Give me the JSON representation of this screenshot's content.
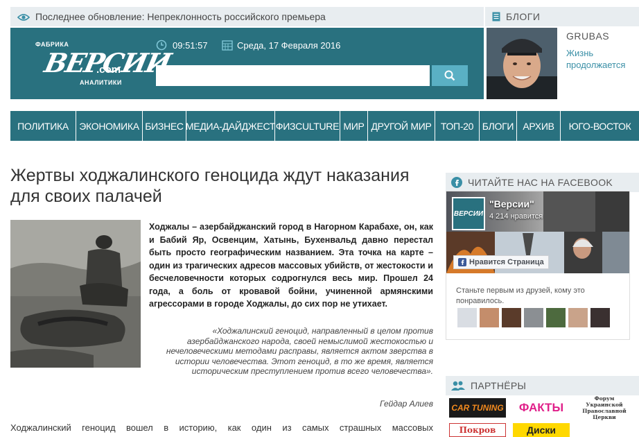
{
  "topbar": {
    "update_text": "Последнее обновление: Непреклонность российского премьера"
  },
  "blogs": {
    "label": "БЛОГИ",
    "author": "GRUBAS",
    "post": "Жизнь продолжается"
  },
  "logo": {
    "top": "ФАБРИКА",
    "main": "ВЕРСИИ",
    "domain": ".com",
    "bottom": "АНАЛИТИКИ"
  },
  "header": {
    "time": "09:51:57",
    "date": "Среда, 17 Февраля 2016"
  },
  "search": {
    "value": "",
    "placeholder": ""
  },
  "nav": {
    "items": [
      "ПОЛИТИКА",
      "ЭКОНОМИКА",
      "БИЗНЕС",
      "МЕДИА-ДАЙДЖЕСТ",
      "ФИЗCULTURE",
      "МИР",
      "ДРУГОЙ МИР",
      "ТОП-20",
      "БЛОГИ",
      "АРХИВ",
      "ЮГО-ВОСТОК"
    ]
  },
  "article": {
    "title": "Жертвы ходжалинского геноцида ждут наказания для своих палачей",
    "lead": "Ходжалы – азербайджанский город в Нагорном Карабахе, он, как и Бабий Яр, Освенцим, Хатынь, Бухенвальд давно перестал быть просто географическим названием. Эта точка на карте – один из трагических адресов массовых убийств, от жестокости и бесчеловечности которых содрогнулся весь мир. Прошел 24 года, а боль от кровавой бойни, учиненной армянскими агрессорами в городе Ходжалы, до сих пор не утихает.",
    "quote": "«Ходжалинский геноцид, направленный в целом против азербайджанского народа, своей немыслимой жестокостью и нечеловеческими методами расправы, является актом зверства в истории человечества. Этот геноцид, в то же время, является историческим преступлением против всего человечества».",
    "quote_author": "Гейдар Алиев",
    "body": "Ходжалинский геноцид вошел в историю, как один из самых страшных массовых"
  },
  "facebook": {
    "header": "ЧИТАЙТЕ НАС НА FACEBOOK",
    "page_logo": "ВЕРСИИ",
    "page_name": "\"Версии\"",
    "likes": "4 214 нравится",
    "like_button": "Нравится Страница",
    "text": "Станьте первым из друзей, кому это понравилось."
  },
  "partners": {
    "header": "ПАРТНЁРЫ",
    "items": [
      "CAR TUNING",
      "ФАКТЫ",
      "Форум Украинской Православной Церкви",
      "Покров",
      "Диски"
    ]
  },
  "colors": {
    "teal": "#29717f",
    "light_blue": "#5ab0c4",
    "bar_bg": "#e8edf0"
  }
}
